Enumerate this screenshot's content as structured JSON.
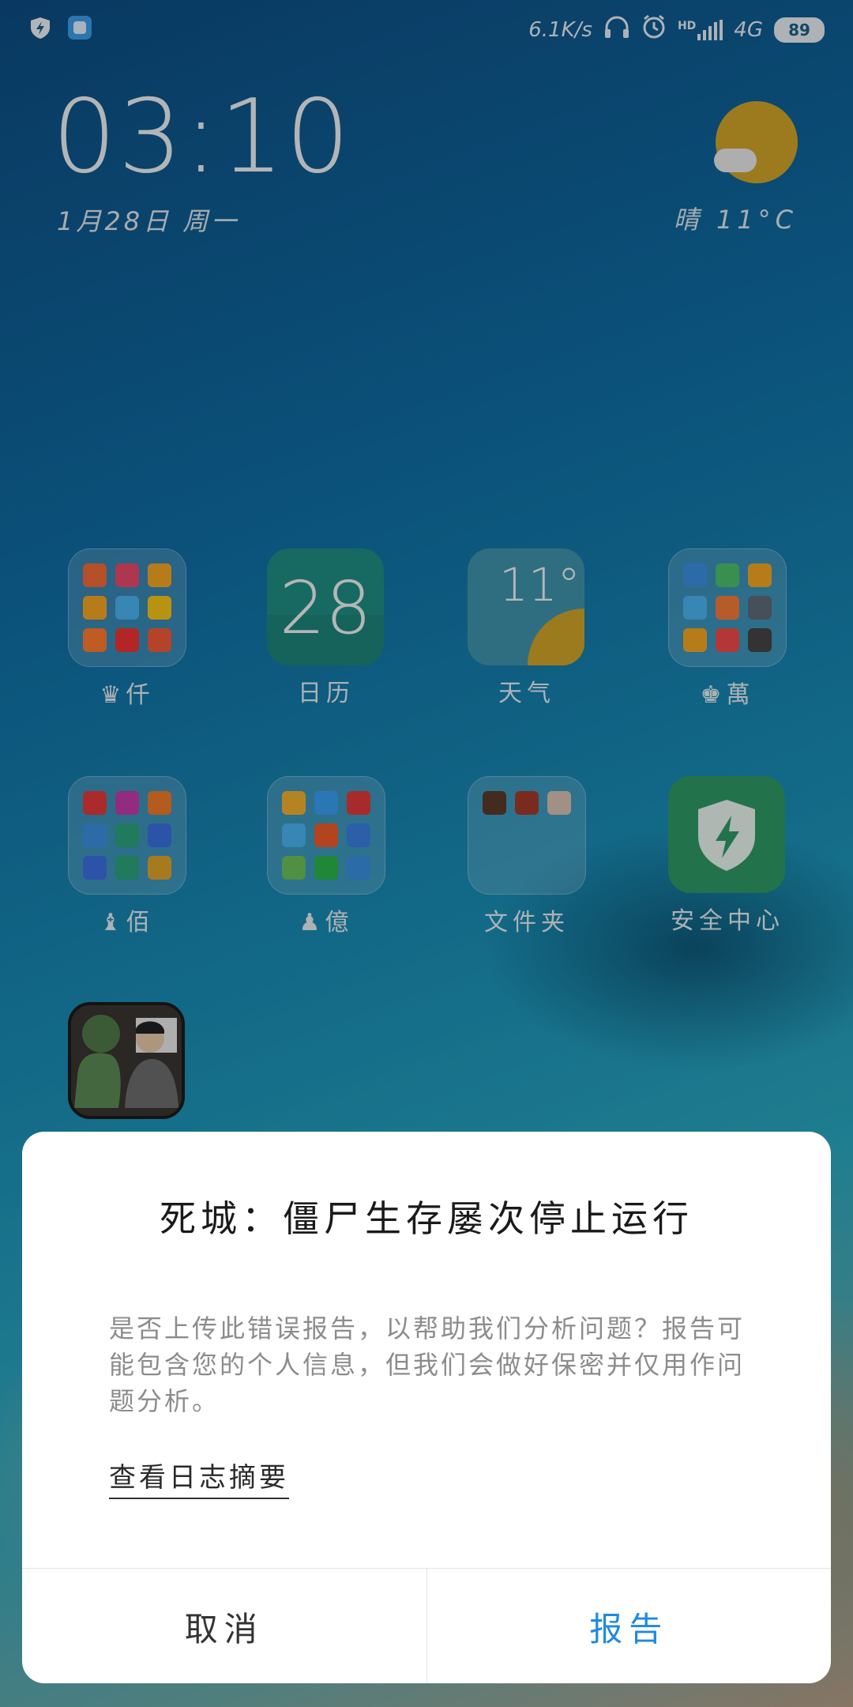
{
  "status_bar": {
    "left_icons": [
      "shield-bolt-icon",
      "app-notification-icon"
    ],
    "net_speed": "6.1K/s",
    "hd_label": "HD",
    "network": "4G",
    "battery": "89",
    "right_icons": [
      "headphones-icon",
      "alarm-icon",
      "signal-icon",
      "battery-icon"
    ]
  },
  "clock_widget": {
    "time": "03:10",
    "date": "1月28日 周一"
  },
  "weather_widget": {
    "condition": "晴",
    "temperature": "11°C",
    "icon": "sun-cloud-icon"
  },
  "apps": [
    {
      "label": "♛仟",
      "type": "folder"
    },
    {
      "label": "日历",
      "type": "app",
      "value": "28"
    },
    {
      "label": "天气",
      "type": "app",
      "value": "11°"
    },
    {
      "label": "♚萬",
      "type": "folder"
    },
    {
      "label": "♝佰",
      "type": "folder"
    },
    {
      "label": "♟億",
      "type": "folder"
    },
    {
      "label": "文件夹",
      "type": "folder"
    },
    {
      "label": "安全中心",
      "type": "app",
      "icon": "security-shield-icon"
    },
    {
      "label": "",
      "type": "app",
      "icon": "game-icon"
    }
  ],
  "colors": {
    "dialog_bg": "#ffffff",
    "accent": "#1f8ae0",
    "weather_sun": "#d0a52a",
    "security_green": "#2e9866",
    "calendar_teal": "#1f8e82"
  },
  "dialog": {
    "title": "死城：僵尸生存屡次停止运行",
    "message": "是否上传此错误报告，以帮助我们分析问题？报告可能包含您的个人信息，但我们会做好保密并仅用作问题分析。",
    "link": "查看日志摘要",
    "cancel": "取消",
    "report": "报告"
  }
}
